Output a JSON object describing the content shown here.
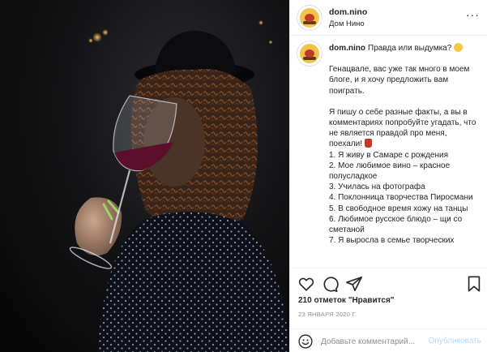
{
  "post": {
    "username": "dom.nino",
    "location": "Дом Нино",
    "more_icon": "more-horizontal-icon"
  },
  "caption": {
    "username": "dom.nino",
    "title": "Правда или выдумка?",
    "intro": "Генацвале, вас уже так много в моем блоге, и я хочу предложить вам поиграть.",
    "rules": "Я пишу о себе разные факты, а вы в комментариях попробуйте угадать, что не является правдой про меня, поехали!",
    "facts": [
      "1. Я живу в Самаре с рождения",
      "2. Мое любимое вино – красное полусладкое",
      "3. Училась на фотографа",
      "4. Поклонница творчества Пиросмани",
      "5. В свободное время хожу на танцы",
      "6. Любимое русское блюдо – щи со сметаной",
      "7. Я выросла в семье творческих"
    ]
  },
  "actions": {
    "icons": [
      "heart-icon",
      "comment-icon",
      "share-icon",
      "bookmark-icon"
    ],
    "likes": "210 отметок \"Нравится\"",
    "date": "23 января 2020 г."
  },
  "comment": {
    "placeholder": "Добавьте комментарий...",
    "publish_label": "Опубликовать",
    "emoji_icon": "smiley-icon"
  },
  "colors": {
    "text": "#262626",
    "muted": "#8e8e8e",
    "border": "#efefef",
    "publish_disabled": "#b3dbff"
  }
}
